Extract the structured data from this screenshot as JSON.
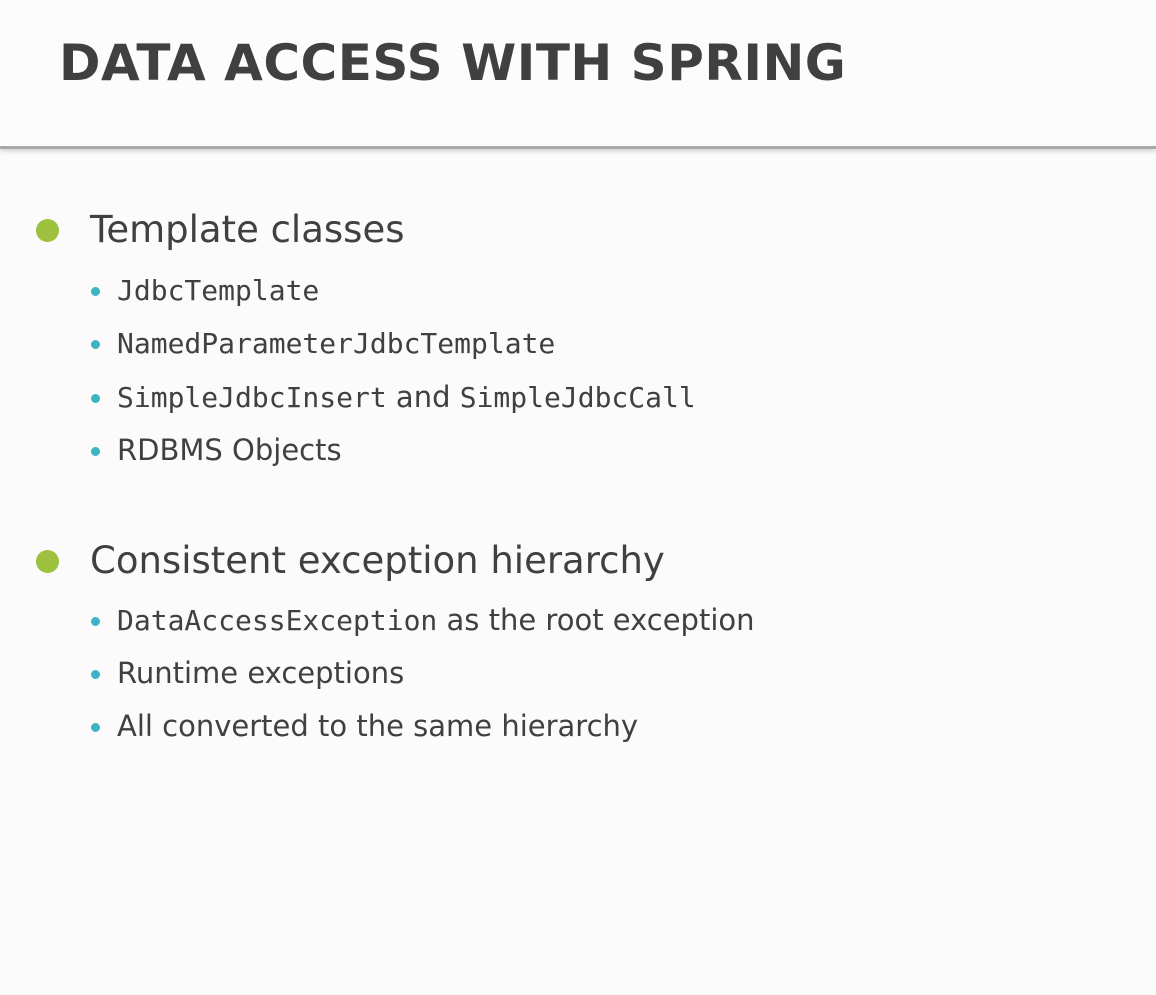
{
  "slide": {
    "title": "DATA ACCESS WITH SPRING",
    "colors": {
      "title_text": "#404040",
      "body_text": "#404040",
      "level1_bullet": "#9dc03e",
      "level2_bullet": "#3bb4c4",
      "background": "#fbfbfb"
    },
    "sections": [
      {
        "heading": "Template classes",
        "items": [
          {
            "code": "JdbcTemplate"
          },
          {
            "code": "NamedParameterJdbcTemplate"
          },
          {
            "code": "SimpleJdbcInsert",
            "middle": " and ",
            "code2": "SimpleJdbcCall"
          },
          {
            "text": "RDBMS Objects"
          }
        ]
      },
      {
        "heading": "Consistent exception hierarchy",
        "items": [
          {
            "code": "DataAccessException",
            "text": " as the root exception"
          },
          {
            "text": "Runtime exceptions"
          },
          {
            "text": "All converted to the same hierarchy"
          }
        ]
      }
    ]
  }
}
